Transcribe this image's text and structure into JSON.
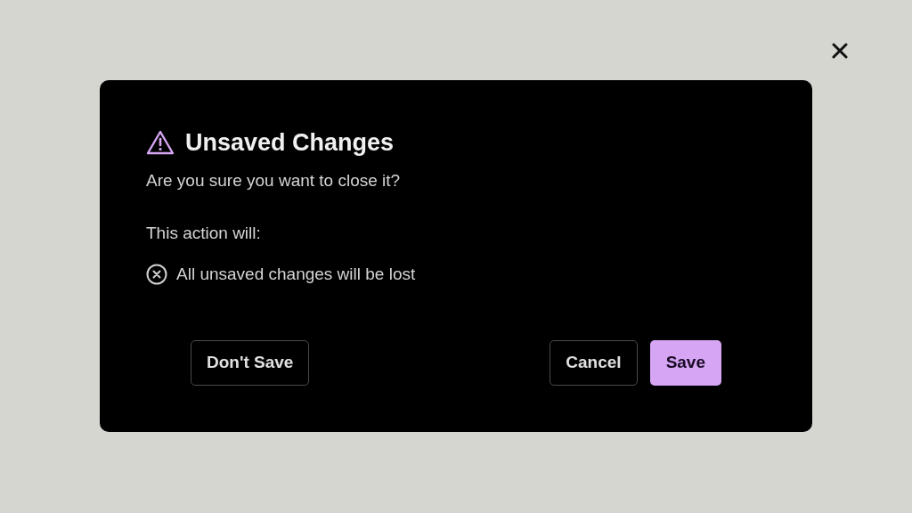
{
  "dialog": {
    "title": "Unsaved Changes",
    "message": "Are you sure you want to close it?",
    "list_heading": "This action will:",
    "consequences": [
      "All unsaved changes will be lost"
    ],
    "buttons": [
      {
        "label": "Don't Save",
        "kind": "secondary"
      },
      {
        "label": "Cancel",
        "kind": "secondary"
      },
      {
        "label": "Save",
        "kind": "primary"
      }
    ]
  }
}
